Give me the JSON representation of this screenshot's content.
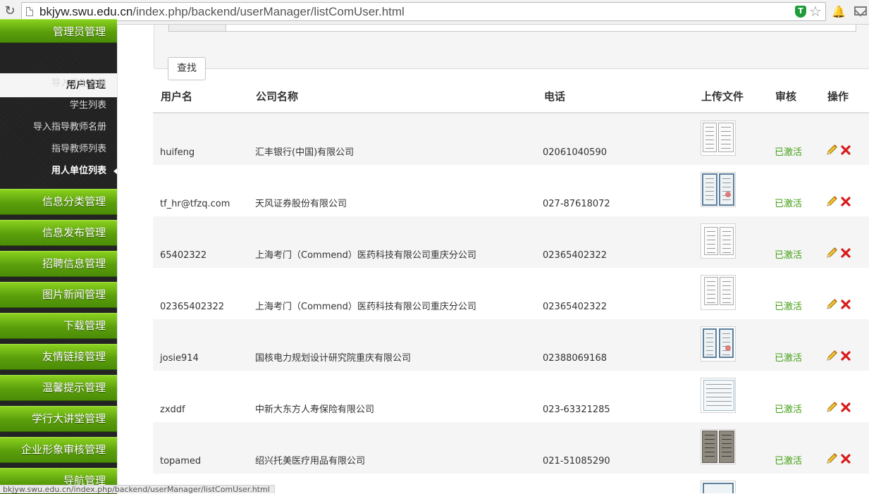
{
  "browser": {
    "url_host": "bkjyw.swu.edu.cn",
    "url_path": "/index.php/backend/userManager/listComUser.html",
    "status_text": "bkjyw.swu.edu.cn/index.php/backend/userManager/listComUser.html"
  },
  "sidebar": {
    "top_partial": "管理员管理",
    "active_section": "用户管理",
    "sub_items": [
      "导入学生名册",
      "学生列表",
      "导入指导教师名册",
      "指导教师列表",
      "用人单位列表"
    ],
    "current_sub": "用人单位列表",
    "sections": [
      "信息分类管理",
      "信息发布管理",
      "招聘信息管理",
      "图片新闻管理",
      "下载管理",
      "友情链接管理",
      "温馨提示管理",
      "学行大讲堂管理",
      "企业形象审核管理",
      "导航管理"
    ]
  },
  "search": {
    "button_label": "查找"
  },
  "table": {
    "headers": {
      "username": "用户名",
      "company": "公司名称",
      "phone": "电话",
      "upload": "上传文件",
      "review": "审核",
      "action": "操作"
    },
    "rows": [
      {
        "username": "huifeng",
        "company": "汇丰银行(中国)有限公司",
        "phone": "02061040590",
        "status": "已激活"
      },
      {
        "username": "tf_hr@tfzq.com",
        "company": "天风证券股份有限公司",
        "phone": "027-87618072",
        "status": "已激活"
      },
      {
        "username": "65402322",
        "company": "上海考门（Commend）医药科技有限公司重庆分公司",
        "phone": "02365402322",
        "status": "已激活"
      },
      {
        "username": "02365402322",
        "company": "上海考门（Commend）医药科技有限公司重庆分公司",
        "phone": "02365402322",
        "status": "已激活"
      },
      {
        "username": "josie914",
        "company": "国核电力规划设计研究院重庆有限公司",
        "phone": "02388069168",
        "status": "已激活"
      },
      {
        "username": "zxddf",
        "company": "中新大东方人寿保险有限公司",
        "phone": "023-63321285",
        "status": "已激活"
      },
      {
        "username": "topamed",
        "company": "绍兴托美医疗用品有限公司",
        "phone": "021-51085290",
        "status": "已激活"
      }
    ]
  },
  "colors": {
    "nav_green": "#5a9e0b",
    "status_green": "#44a014",
    "delete_red": "#d81b1b",
    "sidebar_dark": "#242424"
  }
}
